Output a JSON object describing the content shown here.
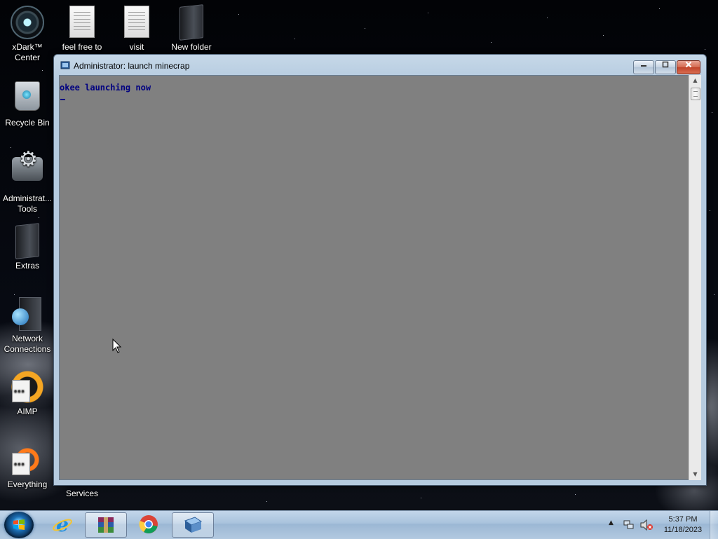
{
  "desktop": {
    "icons": [
      {
        "label": "xDark™\nCenter"
      },
      {
        "label": "feel free to"
      },
      {
        "label": "visit"
      },
      {
        "label": "New folder"
      },
      {
        "label": "Recycle Bin"
      },
      {
        "label": "Administrat...\nTools"
      },
      {
        "label": "Extras"
      },
      {
        "label": "Network\nConnections"
      },
      {
        "label": "AIMP"
      },
      {
        "label": "Everything"
      },
      {
        "label": "Services"
      }
    ]
  },
  "window": {
    "title": "Administrator:  launch minecrap",
    "minimize_label": "minimize",
    "maximize_label": "maximize",
    "close_label": "close",
    "console_output": "okee launching now",
    "console_background": "#808080",
    "console_text_color": "#000080"
  },
  "taskbar": {
    "items": [
      "Internet Explorer",
      "WinRAR",
      "Google Chrome",
      "Command Prompt"
    ],
    "active_item": "Command Prompt",
    "clock": {
      "time": "5:37 PM",
      "date": "11/18/2023"
    }
  },
  "colors": {
    "title_bar": "#b4cadf",
    "close_button": "#c0432a",
    "taskbar": "#a8c2dc"
  }
}
